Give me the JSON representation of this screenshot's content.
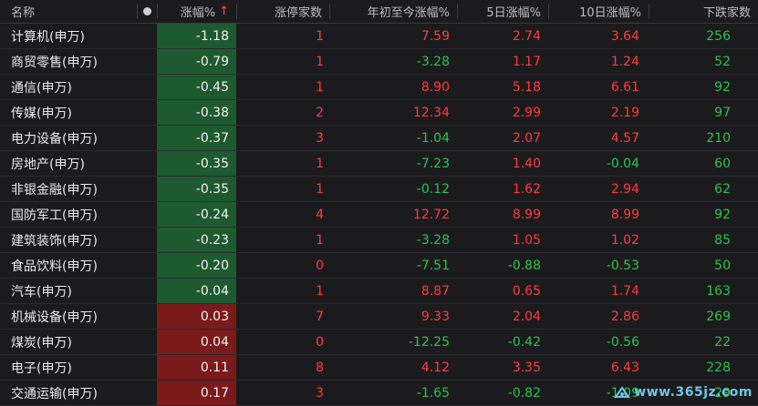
{
  "header": {
    "name": "名称",
    "change_pct": "涨幅%",
    "sort_indicator": "↑",
    "limit_up_count": "涨停家数",
    "ytd_change": "年初至今涨幅%",
    "d5_change": "5日涨幅%",
    "d10_change": "10日涨幅%",
    "down_count": "下跌家数"
  },
  "colors": {
    "rise": "#ff3b3b",
    "fall": "#2ec24f",
    "cell_fall_bg": "#1e5a30",
    "cell_rise_bg": "#7a1a1a"
  },
  "rows": [
    {
      "name": "计算机(申万)",
      "chg": "-1.18",
      "limit": "1",
      "ytd": "7.59",
      "d5": "2.74",
      "d10": "3.64",
      "down": "256"
    },
    {
      "name": "商贸零售(申万)",
      "chg": "-0.79",
      "limit": "1",
      "ytd": "-3.28",
      "d5": "1.17",
      "d10": "1.24",
      "down": "52"
    },
    {
      "name": "通信(申万)",
      "chg": "-0.45",
      "limit": "1",
      "ytd": "8.90",
      "d5": "5.18",
      "d10": "6.61",
      "down": "92"
    },
    {
      "name": "传媒(申万)",
      "chg": "-0.38",
      "limit": "2",
      "ytd": "12.34",
      "d5": "2.99",
      "d10": "2.19",
      "down": "97"
    },
    {
      "name": "电力设备(申万)",
      "chg": "-0.37",
      "limit": "3",
      "ytd": "-1.04",
      "d5": "2.07",
      "d10": "4.57",
      "down": "210"
    },
    {
      "name": "房地产(申万)",
      "chg": "-0.35",
      "limit": "1",
      "ytd": "-7.23",
      "d5": "1.40",
      "d10": "-0.04",
      "down": "60"
    },
    {
      "name": "非银金融(申万)",
      "chg": "-0.35",
      "limit": "1",
      "ytd": "-0.12",
      "d5": "1.62",
      "d10": "2.94",
      "down": "62"
    },
    {
      "name": "国防军工(申万)",
      "chg": "-0.24",
      "limit": "4",
      "ytd": "12.72",
      "d5": "8.99",
      "d10": "8.99",
      "down": "92"
    },
    {
      "name": "建筑装饰(申万)",
      "chg": "-0.23",
      "limit": "1",
      "ytd": "-3.28",
      "d5": "1.05",
      "d10": "1.02",
      "down": "85"
    },
    {
      "name": "食品饮料(申万)",
      "chg": "-0.20",
      "limit": "0",
      "ytd": "-7.51",
      "d5": "-0.88",
      "d10": "-0.53",
      "down": "50"
    },
    {
      "name": "汽车(申万)",
      "chg": "-0.04",
      "limit": "1",
      "ytd": "8.87",
      "d5": "0.65",
      "d10": "1.74",
      "down": "163"
    },
    {
      "name": "机械设备(申万)",
      "chg": "0.03",
      "limit": "7",
      "ytd": "9.33",
      "d5": "2.04",
      "d10": "2.86",
      "down": "269"
    },
    {
      "name": "煤炭(申万)",
      "chg": "0.04",
      "limit": "0",
      "ytd": "-12.25",
      "d5": "-0.42",
      "d10": "-0.56",
      "down": "22"
    },
    {
      "name": "电子(申万)",
      "chg": "0.11",
      "limit": "8",
      "ytd": "4.12",
      "d5": "3.35",
      "d10": "6.43",
      "down": "228"
    },
    {
      "name": "交通运输(申万)",
      "chg": "0.17",
      "limit": "3",
      "ytd": "-1.65",
      "d5": "-0.82",
      "d10": "-1.09",
      "down": "29"
    }
  ],
  "watermark": {
    "text": "www.365jz.com"
  }
}
